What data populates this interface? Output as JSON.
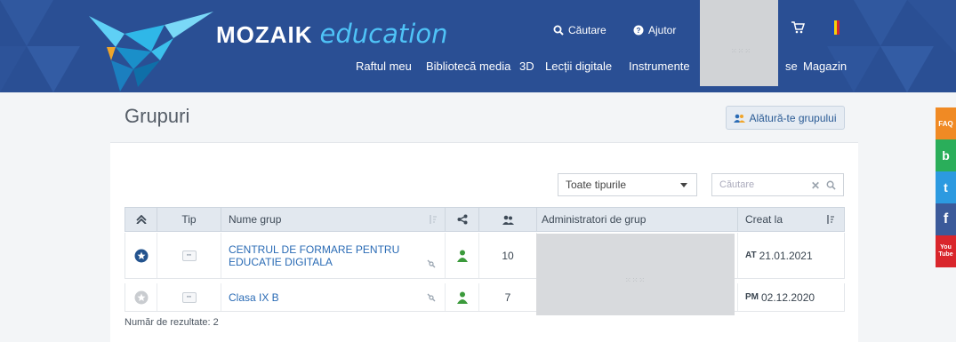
{
  "header": {
    "logo_mozaik": "MOZAIK",
    "logo_education": "education",
    "search_label": "Căutare",
    "help_label": "Ajutor",
    "nav": [
      "Raftul meu",
      "Bibliotecă media",
      "3D",
      "Lecții digitale",
      "Instrumente",
      "se",
      "Magazin"
    ],
    "profile_placeholder": "⁙⁙⁙"
  },
  "page": {
    "title": "Grupuri",
    "join_button": "Alătură-te grupului",
    "side_labels": [
      "FAQ",
      "b",
      "t",
      "f",
      "You Tube"
    ]
  },
  "filters": {
    "type_select": "Toate tipurile",
    "search_placeholder": "Căutare"
  },
  "table": {
    "headers": {
      "tip": "Tip",
      "nume": "Nume grup",
      "admin": "Administratori de grup",
      "creat": "Creat la"
    },
    "rows": [
      {
        "name": "CENTRUL DE FORMARE PENTRU EDUCATIE DIGITALA",
        "members": "10",
        "time_prefix": "AT",
        "date": "21.01.2021",
        "starred": true
      },
      {
        "name": "Clasa IX B",
        "members": "7",
        "time_prefix": "PM",
        "date": "02.12.2020",
        "starred": false
      }
    ],
    "results_label": "Număr de rezultate: 2"
  },
  "colors": {
    "header_bg": "#2a4f94",
    "accent_blue": "#4fc3f7",
    "link": "#2a6bb5",
    "member_icon": "#3b9a3b"
  }
}
